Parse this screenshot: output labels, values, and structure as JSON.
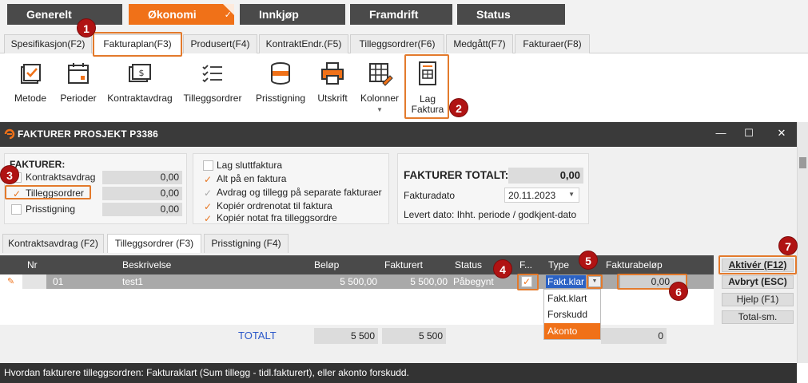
{
  "colors": {
    "accent": "#f07118",
    "dark": "#3a3a3a",
    "header": "#4a4a4a",
    "badge": "#b01313"
  },
  "module_tabs": [
    {
      "label": "Generelt"
    },
    {
      "label": "Økonomi"
    },
    {
      "label": "Innkjøp"
    },
    {
      "label": "Framdrift"
    },
    {
      "label": "Status"
    }
  ],
  "sub_tabs": [
    {
      "label": "Spesifikasjon(F2)"
    },
    {
      "label": "Fakturaplan(F3)"
    },
    {
      "label": "Produsert(F4)"
    },
    {
      "label": "KontraktEndr.(F5)"
    },
    {
      "label": "Tilleggsordrer(F6)"
    },
    {
      "label": "Medgått(F7)"
    },
    {
      "label": "Fakturaer(F8)"
    }
  ],
  "ribbon": [
    {
      "label": "Metode",
      "icon": "method-icon"
    },
    {
      "label": "Perioder",
      "icon": "calendar-icon"
    },
    {
      "label": "Kontraktavdrag",
      "icon": "money-icon"
    },
    {
      "label": "Tilleggsordrer",
      "icon": "checklist-icon"
    },
    {
      "label": "Prisstigning",
      "icon": "coins-icon"
    },
    {
      "label": "Utskrift",
      "icon": "printer-icon"
    },
    {
      "label": "Kolonner",
      "icon": "columns-icon"
    },
    {
      "label_line1": "Lag",
      "label_line2": "Faktura",
      "icon": "invoice-icon"
    }
  ],
  "dialog": {
    "title": "FAKTURER PROSJEKT P3386",
    "fakturer_label": "FAKTURER:",
    "left_items": [
      {
        "label": "Kontraktsavdrag",
        "value": "0,00"
      },
      {
        "label": "Tilleggsordrer",
        "value": "0,00"
      },
      {
        "label": "Prisstigning",
        "value": "0,00"
      }
    ],
    "options": [
      {
        "label": "Lag sluttfaktura"
      },
      {
        "label": "Alt på en faktura"
      },
      {
        "label": "Avdrag og tillegg på separate fakturaer"
      },
      {
        "label": "Kopiér ordrenotat til faktura"
      },
      {
        "label": "Kopiér notat fra tilleggsordre"
      }
    ],
    "total_label": "FAKTURER TOTALT:",
    "total_value": "0,00",
    "fakturadato_label": "Fakturadato",
    "fakturadato_value": "20.11.2023",
    "levert_text": "Levert dato: Ihht. periode / godkjent-dato",
    "inner_tabs": [
      {
        "label": "Kontraktsavdrag (F2)"
      },
      {
        "label": "Tilleggsordrer (F3)"
      },
      {
        "label": "Prisstigning (F4)"
      }
    ],
    "grid": {
      "headers": {
        "nr": "Nr",
        "beskrivelse": "Beskrivelse",
        "belop": "Beløp",
        "fakturert": "Fakturert",
        "status": "Status",
        "f": "F...",
        "type": "Type",
        "fakturabelop": "Fakturabeløp"
      },
      "row": {
        "nr": "01",
        "beskrivelse": "test1",
        "belop": "5 500,00",
        "fakturert": "5 500,00",
        "status": "Påbegynt",
        "type": "Fakt.klar",
        "fakturabelop": "0,00"
      },
      "dropdown": [
        "Fakt.klart",
        "Forskudd",
        "Akonto"
      ],
      "total_label": "TOTALT",
      "total_belop": "5 500",
      "total_fakturert": "5 500",
      "total_fakturabelop": "0"
    },
    "buttons": [
      {
        "label": "Aktivér (F12)"
      },
      {
        "label": "Avbryt (ESC)"
      },
      {
        "label": "Hjelp (F1)"
      },
      {
        "label": "Total-sm."
      }
    ]
  },
  "status_text": "Hvordan fakturere tilleggsordren: Fakturaklart (Sum tillegg - tidl.fakturert), eller akonto forskudd.",
  "callouts": [
    "1",
    "2",
    "3",
    "4",
    "5",
    "6",
    "7"
  ]
}
